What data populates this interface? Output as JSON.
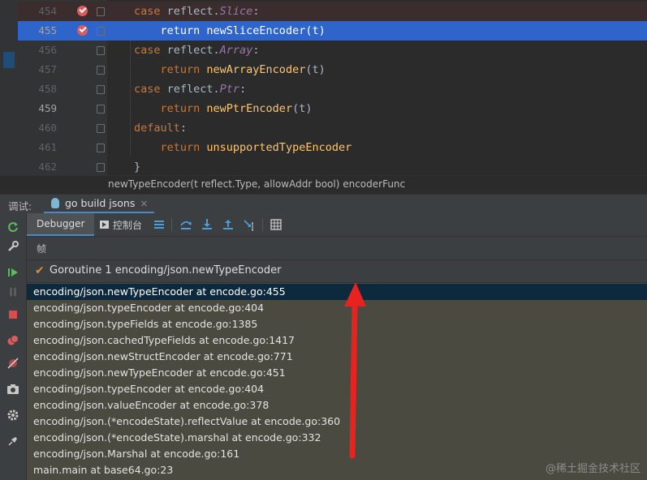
{
  "editor": {
    "lines": [
      {
        "num": "454",
        "breakpoint": true,
        "parts": [
          {
            "t": "case ",
            "c": "kw"
          },
          {
            "t": "reflect.",
            "c": "plain"
          },
          {
            "t": "Slice",
            "c": "it"
          },
          {
            "t": ":",
            "c": "plain"
          }
        ]
      },
      {
        "num": "455",
        "breakpoint": true,
        "current": true,
        "parts": [
          {
            "t": "    return ",
            "c": "kw"
          },
          {
            "t": "newSliceEncoder",
            "c": "fn"
          },
          {
            "t": "(t)",
            "c": "plain"
          }
        ]
      },
      {
        "num": "456",
        "parts": [
          {
            "t": "case ",
            "c": "kw"
          },
          {
            "t": "reflect.",
            "c": "plain"
          },
          {
            "t": "Array",
            "c": "it"
          },
          {
            "t": ":",
            "c": "plain"
          }
        ]
      },
      {
        "num": "457",
        "parts": [
          {
            "t": "    return ",
            "c": "kw"
          },
          {
            "t": "newArrayEncoder",
            "c": "fn"
          },
          {
            "t": "(t)",
            "c": "plain"
          }
        ]
      },
      {
        "num": "458",
        "parts": [
          {
            "t": "case ",
            "c": "kw"
          },
          {
            "t": "reflect.",
            "c": "plain"
          },
          {
            "t": "Ptr",
            "c": "it"
          },
          {
            "t": ":",
            "c": "plain"
          }
        ]
      },
      {
        "num": "459",
        "active": true,
        "parts": [
          {
            "t": "    return ",
            "c": "kw"
          },
          {
            "t": "newPtrEncoder",
            "c": "fn"
          },
          {
            "t": "(t)",
            "c": "plain"
          }
        ]
      },
      {
        "num": "460",
        "parts": [
          {
            "t": "default",
            "c": "kw"
          },
          {
            "t": ":",
            "c": "plain"
          }
        ]
      },
      {
        "num": "461",
        "parts": [
          {
            "t": "    return ",
            "c": "kw"
          },
          {
            "t": "unsupportedTypeEncoder",
            "c": "fn"
          }
        ]
      },
      {
        "num": "462",
        "parts": [
          {
            "t": "}",
            "c": "plain"
          }
        ]
      }
    ],
    "hint": "newTypeEncoder(t reflect.Type, allowAddr bool) encoderFunc"
  },
  "tool_window": {
    "title": "调试:",
    "tab_label": "go build jsons",
    "tab_close": "×"
  },
  "debug_toolbar": {
    "debugger_tab": "Debugger",
    "console_tab": "控制台"
  },
  "frames": {
    "label": "帧",
    "goroutine": "Goroutine 1 encoding/json.newTypeEncoder",
    "items": [
      "encoding/json.newTypeEncoder at encode.go:455",
      "encoding/json.typeEncoder at encode.go:404",
      "encoding/json.typeFields at encode.go:1385",
      "encoding/json.cachedTypeFields at encode.go:1417",
      "encoding/json.newStructEncoder at encode.go:771",
      "encoding/json.newTypeEncoder at encode.go:451",
      "encoding/json.typeEncoder at encode.go:404",
      "encoding/json.valueEncoder at encode.go:378",
      "encoding/json.(*encodeState).reflectValue at encode.go:360",
      "encoding/json.(*encodeState).marshal at encode.go:332",
      "encoding/json.Marshal at encode.go:161",
      "main.main at base64.go:23"
    ]
  },
  "watermark": "@稀土掘金技术社区",
  "colors": {
    "accent": "#4a88c7",
    "current_line": "#2f65ca",
    "breakpoint": "#db5c5c",
    "arrow": "#e8221e"
  }
}
